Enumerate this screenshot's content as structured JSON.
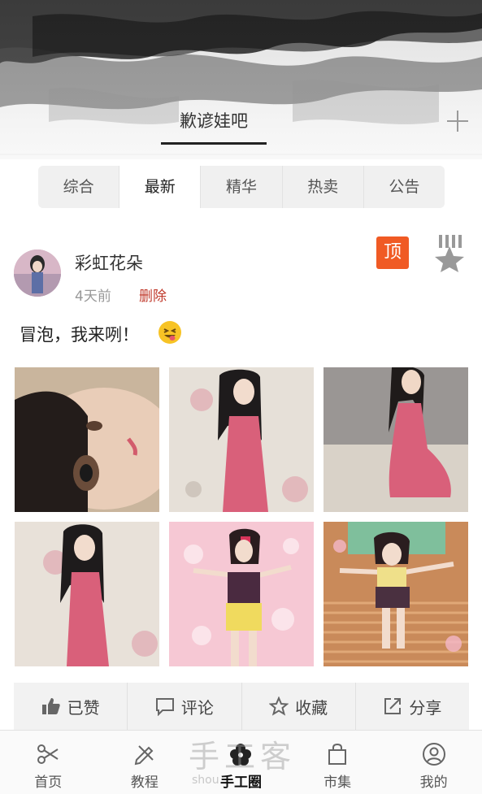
{
  "header": {
    "group_name": "歉谚娃吧"
  },
  "filter_tabs": [
    {
      "label": "综合"
    },
    {
      "label": "最新"
    },
    {
      "label": "精华"
    },
    {
      "label": "热卖"
    },
    {
      "label": "公告"
    }
  ],
  "filter_active": "最新",
  "post": {
    "author": "彩虹花朵",
    "time": "4天前",
    "delete_label": "删除",
    "top_badge": "顶",
    "text": "冒泡，我来咧！",
    "emoji": "grinning-tongue-emoji"
  },
  "actions": {
    "like": "已赞",
    "comment": "评论",
    "favorite": "收藏",
    "share": "分享"
  },
  "nav": {
    "home": "首页",
    "tutorial": "教程",
    "circle": "手工圈",
    "market": "市集",
    "mine": "我的"
  },
  "watermark": {
    "text": "手工客",
    "sub": "shou"
  },
  "colors": {
    "accent": "#f05a24",
    "delete": "#c0392b"
  }
}
